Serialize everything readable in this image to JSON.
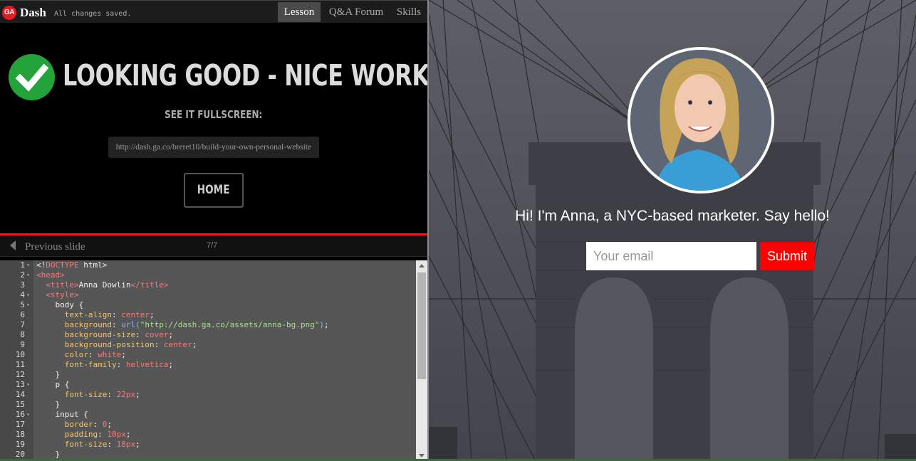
{
  "header": {
    "logo_text": "GA",
    "app_name": "Dash",
    "save_status": "All changes saved.",
    "tabs": [
      {
        "label": "Lesson",
        "active": true
      },
      {
        "label": "Q&A Forum",
        "active": false
      },
      {
        "label": "Skills",
        "active": false
      }
    ]
  },
  "success": {
    "icon": "checkmark-icon",
    "headline": "LOOKING GOOD - NICE WORK!",
    "fullscreen_label": "SEE IT FULLSCREEN:",
    "url": "http://dash.ga.co/breret10/build-your-own-personal-website",
    "home_label": "HOME"
  },
  "slide_nav": {
    "prev_label": "Previous slide",
    "counter": "7/7"
  },
  "editor": {
    "lines": [
      {
        "n": "1",
        "fold": true,
        "segs": [
          [
            "p",
            "<!"
          ],
          [
            "tag",
            "DOCTYPE"
          ],
          [
            "p",
            " html>"
          ]
        ]
      },
      {
        "n": "2",
        "fold": true,
        "segs": [
          [
            "tag",
            "<head>"
          ]
        ]
      },
      {
        "n": "3",
        "fold": false,
        "segs": [
          [
            "p",
            "  "
          ],
          [
            "tag",
            "<title>"
          ],
          [
            "p",
            "Anna Dowlin"
          ],
          [
            "tag",
            "</title>"
          ]
        ]
      },
      {
        "n": "4",
        "fold": true,
        "segs": [
          [
            "p",
            "  "
          ],
          [
            "tag",
            "<style>"
          ]
        ]
      },
      {
        "n": "5",
        "fold": true,
        "segs": [
          [
            "p",
            "    body {"
          ]
        ]
      },
      {
        "n": "6",
        "fold": false,
        "segs": [
          [
            "p",
            "      "
          ],
          [
            "prop",
            "text-align"
          ],
          [
            "p",
            ": "
          ],
          [
            "val",
            "center"
          ],
          [
            "p",
            ";"
          ]
        ]
      },
      {
        "n": "7",
        "fold": false,
        "segs": [
          [
            "p",
            "      "
          ],
          [
            "prop",
            "background"
          ],
          [
            "p",
            ": "
          ],
          [
            "fn",
            "url("
          ],
          [
            "str",
            "\"http://dash.ga.co/assets/anna-bg.png\""
          ],
          [
            "fn",
            ")"
          ],
          [
            "p",
            ";"
          ]
        ]
      },
      {
        "n": "8",
        "fold": false,
        "segs": [
          [
            "p",
            "      "
          ],
          [
            "prop",
            "background-size"
          ],
          [
            "p",
            ": "
          ],
          [
            "val",
            "cover"
          ],
          [
            "p",
            ";"
          ]
        ]
      },
      {
        "n": "9",
        "fold": false,
        "segs": [
          [
            "p",
            "      "
          ],
          [
            "prop",
            "background-position"
          ],
          [
            "p",
            ": "
          ],
          [
            "val",
            "center"
          ],
          [
            "p",
            ";"
          ]
        ]
      },
      {
        "n": "10",
        "fold": false,
        "segs": [
          [
            "p",
            "      "
          ],
          [
            "prop",
            "color"
          ],
          [
            "p",
            ": "
          ],
          [
            "val",
            "white"
          ],
          [
            "p",
            ";"
          ]
        ]
      },
      {
        "n": "11",
        "fold": false,
        "segs": [
          [
            "p",
            "      "
          ],
          [
            "prop",
            "font-family"
          ],
          [
            "p",
            ": "
          ],
          [
            "val",
            "helvetica"
          ],
          [
            "p",
            ";"
          ]
        ]
      },
      {
        "n": "12",
        "fold": false,
        "segs": [
          [
            "p",
            "    }"
          ]
        ]
      },
      {
        "n": "13",
        "fold": true,
        "segs": [
          [
            "p",
            "    p {"
          ]
        ]
      },
      {
        "n": "14",
        "fold": false,
        "segs": [
          [
            "p",
            "      "
          ],
          [
            "prop",
            "font-size"
          ],
          [
            "p",
            ": "
          ],
          [
            "val",
            "22px"
          ],
          [
            "p",
            ";"
          ]
        ]
      },
      {
        "n": "15",
        "fold": false,
        "segs": [
          [
            "p",
            "    }"
          ]
        ]
      },
      {
        "n": "16",
        "fold": true,
        "segs": [
          [
            "p",
            "    input {"
          ]
        ]
      },
      {
        "n": "17",
        "fold": false,
        "segs": [
          [
            "p",
            "      "
          ],
          [
            "prop",
            "border"
          ],
          [
            "p",
            ": "
          ],
          [
            "val",
            "0"
          ],
          [
            "p",
            ";"
          ]
        ]
      },
      {
        "n": "18",
        "fold": false,
        "segs": [
          [
            "p",
            "      "
          ],
          [
            "prop",
            "padding"
          ],
          [
            "p",
            ": "
          ],
          [
            "val",
            "10px"
          ],
          [
            "p",
            ";"
          ]
        ]
      },
      {
        "n": "19",
        "fold": false,
        "segs": [
          [
            "p",
            "      "
          ],
          [
            "prop",
            "font-size"
          ],
          [
            "p",
            ": "
          ],
          [
            "val",
            "18px"
          ],
          [
            "p",
            ";"
          ]
        ]
      },
      {
        "n": "20",
        "fold": false,
        "segs": [
          [
            "p",
            "    }"
          ]
        ]
      }
    ]
  },
  "preview": {
    "greeting": "Hi! I'm Anna, a NYC-based marketer. Say hello!",
    "email_placeholder": "Your email",
    "submit_label": "Submit",
    "accent_color": "#ff0000"
  }
}
